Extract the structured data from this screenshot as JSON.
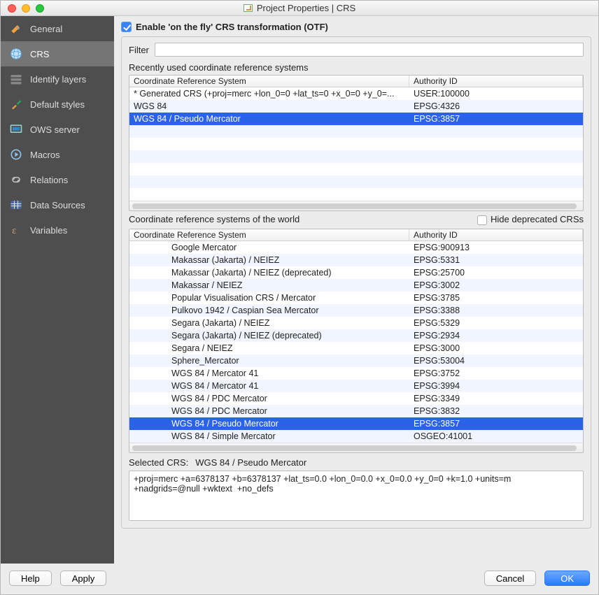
{
  "title": "Project Properties | CRS",
  "sidebar": {
    "items": [
      {
        "label": "General"
      },
      {
        "label": "CRS"
      },
      {
        "label": "Identify layers"
      },
      {
        "label": "Default styles"
      },
      {
        "label": "OWS server"
      },
      {
        "label": "Macros"
      },
      {
        "label": "Relations"
      },
      {
        "label": "Data Sources"
      },
      {
        "label": "Variables"
      }
    ]
  },
  "otf_label": "Enable 'on the fly' CRS transformation (OTF)",
  "filter_label": "Filter",
  "recent_header": "Recently used coordinate reference systems",
  "columns": {
    "name": "Coordinate Reference System",
    "auth": "Authority ID"
  },
  "recent_rows": [
    {
      "name": "* Generated CRS (+proj=merc +lon_0=0 +lat_ts=0 +x_0=0 +y_0=...",
      "auth": "USER:100000",
      "sel": false
    },
    {
      "name": "WGS 84",
      "auth": "EPSG:4326",
      "sel": false
    },
    {
      "name": "WGS 84 / Pseudo Mercator",
      "auth": "EPSG:3857",
      "sel": true
    }
  ],
  "world_header": "Coordinate reference systems of the world",
  "hide_deprecated_label": "Hide deprecated CRSs",
  "world_rows": [
    {
      "name": "Google Mercator",
      "auth": "EPSG:900913",
      "sel": false
    },
    {
      "name": "Makassar (Jakarta) / NEIEZ",
      "auth": "EPSG:5331",
      "sel": false
    },
    {
      "name": "Makassar (Jakarta) / NEIEZ (deprecated)",
      "auth": "EPSG:25700",
      "sel": false
    },
    {
      "name": "Makassar / NEIEZ",
      "auth": "EPSG:3002",
      "sel": false
    },
    {
      "name": "Popular Visualisation CRS / Mercator",
      "auth": "EPSG:3785",
      "sel": false
    },
    {
      "name": "Pulkovo 1942 / Caspian Sea Mercator",
      "auth": "EPSG:3388",
      "sel": false
    },
    {
      "name": "Segara (Jakarta) / NEIEZ",
      "auth": "EPSG:5329",
      "sel": false
    },
    {
      "name": "Segara (Jakarta) / NEIEZ (deprecated)",
      "auth": "EPSG:2934",
      "sel": false
    },
    {
      "name": "Segara / NEIEZ",
      "auth": "EPSG:3000",
      "sel": false
    },
    {
      "name": "Sphere_Mercator",
      "auth": "EPSG:53004",
      "sel": false
    },
    {
      "name": "WGS 84 / Mercator 41",
      "auth": "EPSG:3752",
      "sel": false
    },
    {
      "name": "WGS 84 / Mercator 41",
      "auth": "EPSG:3994",
      "sel": false
    },
    {
      "name": "WGS 84 / PDC Mercator",
      "auth": "EPSG:3349",
      "sel": false
    },
    {
      "name": "WGS 84 / PDC Mercator",
      "auth": "EPSG:3832",
      "sel": false
    },
    {
      "name": "WGS 84 / Pseudo Mercator",
      "auth": "EPSG:3857",
      "sel": true
    },
    {
      "name": "WGS 84 / Simple Mercator",
      "auth": "OSGEO:41001",
      "sel": false
    }
  ],
  "selected_label": "Selected CRS:",
  "selected_value": "WGS 84 / Pseudo Mercator",
  "proj_string": "+proj=merc +a=6378137 +b=6378137 +lat_ts=0.0 +lon_0=0.0 +x_0=0.0 +y_0=0 +k=1.0 +units=m +nadgrids=@null +wktext  +no_defs",
  "buttons": {
    "help": "Help",
    "apply": "Apply",
    "cancel": "Cancel",
    "ok": "OK"
  }
}
